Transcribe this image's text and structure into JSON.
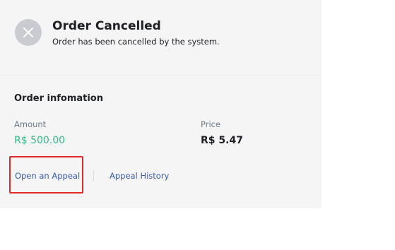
{
  "header": {
    "icon": "close-icon",
    "title": "Order Cancelled",
    "subtitle": "Order has been cancelled by the system."
  },
  "order_info": {
    "section_title": "Order infomation",
    "amount_label": "Amount",
    "amount_value": "R$ 500.00",
    "price_label": "Price",
    "price_value": "R$ 5.47"
  },
  "actions": {
    "appeal_label": "Open an Appeal",
    "history_label": "Appeal History"
  },
  "colors": {
    "amount_green": "#2ebd85",
    "link_blue": "#3b5ab0",
    "highlight_red": "#e12a2a"
  }
}
